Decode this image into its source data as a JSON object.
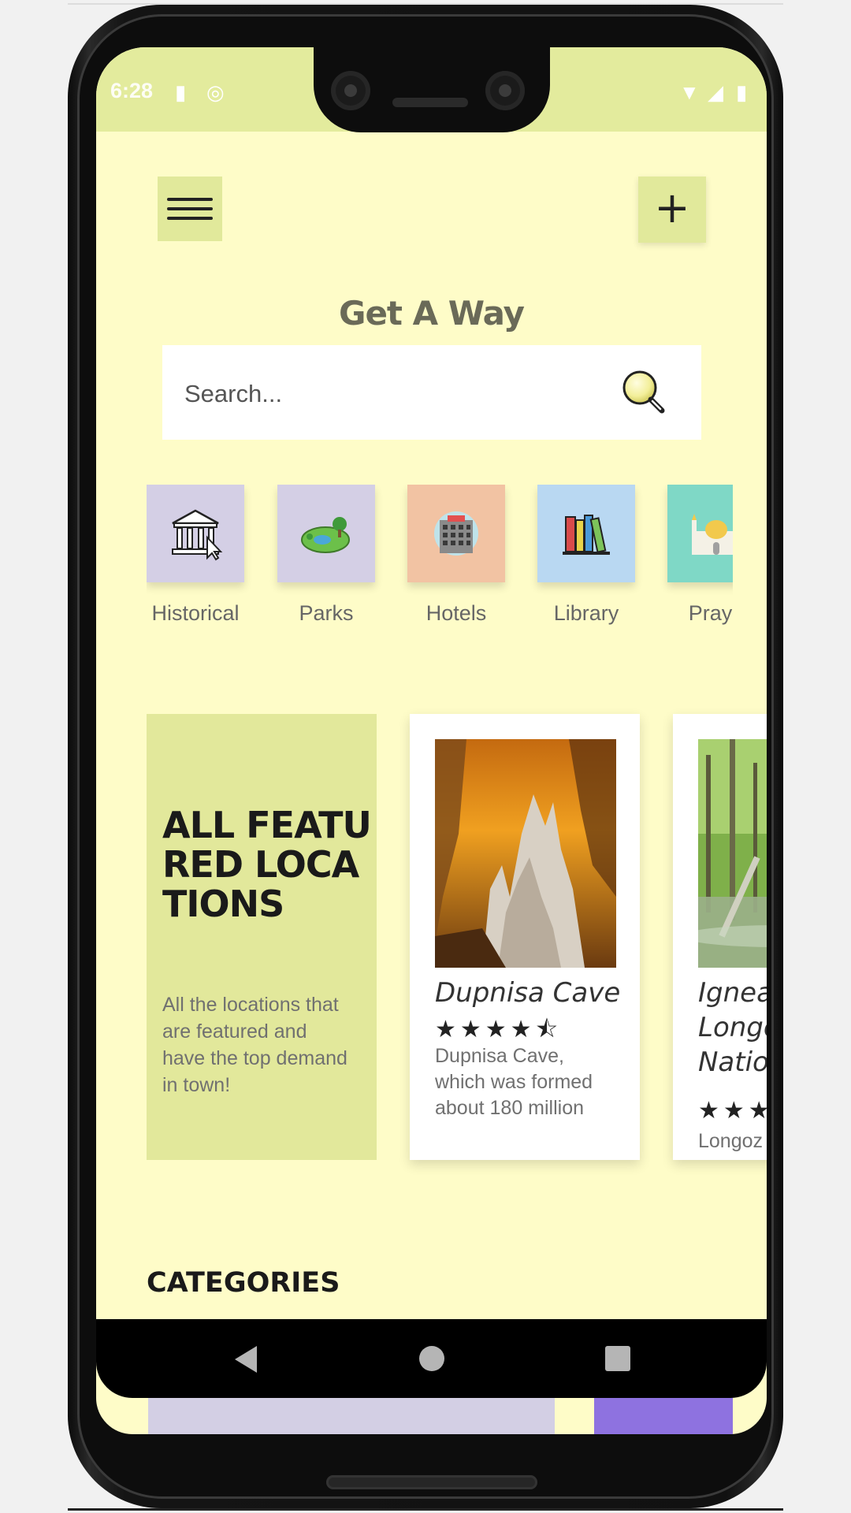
{
  "status": {
    "time": "6:28"
  },
  "header": {
    "title": "Get A Way",
    "menu_icon": "hamburger-menu-icon",
    "add_label": "+"
  },
  "search": {
    "placeholder": "Search...",
    "value": ""
  },
  "categories_strip": [
    {
      "label": "Historical",
      "icon": "museum-icon",
      "color": "#d4cfe5"
    },
    {
      "label": "Parks",
      "icon": "park-icon",
      "color": "#d4cfe5"
    },
    {
      "label": "Hotels",
      "icon": "hotel-icon",
      "color": "#f2c3a3"
    },
    {
      "label": "Library",
      "icon": "books-icon",
      "color": "#b9d8f2"
    },
    {
      "label": "Praye",
      "icon": "mosque-icon",
      "color": "#7fd8c6"
    }
  ],
  "featured": {
    "title": "ALL FEATURED LOCATIONS",
    "description": "All the locations that are featured and have the top demand in town!"
  },
  "locations": [
    {
      "name": "Dupnisa Cave",
      "rating": 4.5,
      "stars": "★★★★⯪",
      "description": "Dupnisa Cave, which was formed about 180 million"
    },
    {
      "name": "Igneada Longoz National",
      "rating": 3,
      "stars": "★★★",
      "description": "Longoz"
    }
  ],
  "categories_section": {
    "title": "CATEGORIES"
  },
  "colors": {
    "background": "#fefcc8",
    "accent": "#e2e89b",
    "card": "#ffffff"
  }
}
